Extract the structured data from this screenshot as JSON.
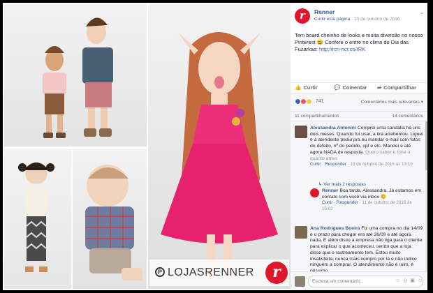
{
  "photos": {
    "watermark_text": "LOJASRENNER",
    "watermark_pin": "P",
    "logo_letter": "r"
  },
  "post": {
    "page_name": "Renner",
    "avatar_letter": "r",
    "follow_label": "Curtir esta página",
    "date": "10 de outubro de 2016",
    "text_main": "Tem board cheinho de looks e muita diversão no nosso Pinterest 😀 Confere o entre no clima do Dia das Fuzarkas:",
    "text_link": "http://rcn-ncr.co/IRK",
    "chevron": "⌄"
  },
  "actions": {
    "like": "Curtir",
    "comment": "Comentar",
    "share": "Compartilhar"
  },
  "reactions": {
    "count": "741",
    "sort_label": "Comentários mais relevantes ▾",
    "colors": {
      "like": "#4267b2",
      "love": "#f25268",
      "haha": "#f7c84b"
    }
  },
  "counts": {
    "shares": "11 compartilhamentos",
    "comments": "14 comentários"
  },
  "comments": [
    {
      "name": "Alessandra Antonini",
      "text": "Comprei uma sandália há uns dois meses. Quando fui usar, a tira arrebentou. Liguei e a atendente pediu pra eu mandar e-mail com fotos do defeito, nº do pedido, cpf e etc. Mandei e até agora NADA de resposta.",
      "text_more": "Quero saber o fone o quanto antes",
      "footer_like": "Curtir",
      "footer_reply": "Responder",
      "footer_date": "10 de outubro de 2016 às 13:19"
    },
    {
      "name": "Renner",
      "text": "Boa tarde, Alessandra. Já estamos em contato com você via inbox 😊",
      "footer_like": "Curtir",
      "footer_reply": "Responder",
      "footer_date": "11 de outubro de 2016 às 15:02"
    },
    {
      "name": "Ana Rodrigues Boeira",
      "text": "Fiz uma compra no dia 14/09 e o prazo para chegar era até 26/09 e até agora nada. E além disso a empresa não liga para o cliente para explicar o que aconteceu, sendo que a loja disse que o rastreamento tem. Estou muito insatisfeita, nunca mais compro por lá e não indico ninguém a comprar. O atendimento não é ruim, é péssimo."
    }
  ],
  "replies_link": "↳ Ver mais 2 respostas",
  "write": {
    "placeholder": "Escreva um comentário...",
    "icons": "☺ ◎ ▣ ☺"
  }
}
